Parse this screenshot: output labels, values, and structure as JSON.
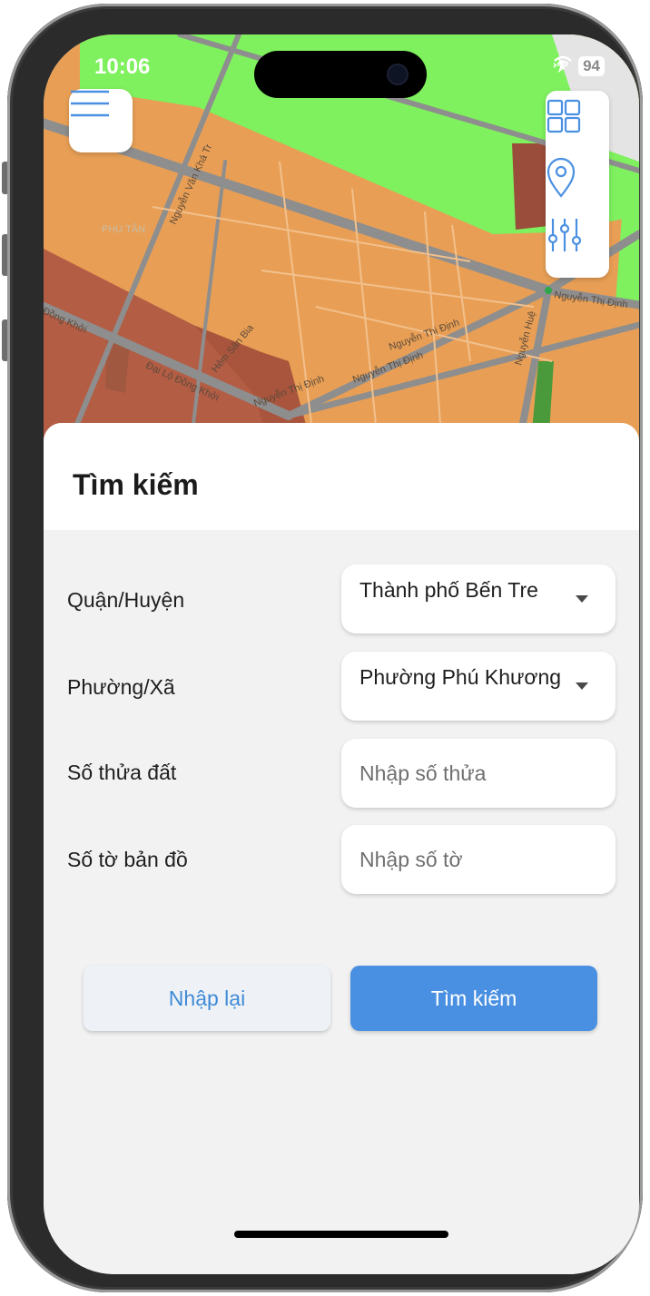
{
  "status_bar": {
    "time": "10:06",
    "battery": "94",
    "icons": [
      "airplane-icon",
      "wifi-icon",
      "battery-icon"
    ]
  },
  "map": {
    "labels": [
      "PHÚ TÂN",
      "Nguyễn Văn Khá Tr",
      "Đồng Khởi",
      "Đại Lộ Đồng Khởi",
      "Hẻm Sân Bia",
      "Nguyễn Thị Định",
      "Nguyễn Thị Định",
      "Nguyễn Thị Định",
      "Nguyễn Thị Định",
      "Nguyễn Huệ"
    ],
    "toolbar_icons": [
      "grid-icon",
      "location-pin-icon",
      "sliders-icon"
    ]
  },
  "sheet": {
    "title": "Tìm kiếm",
    "fields": {
      "district": {
        "label": "Quận/Huyện",
        "value": "Thành phố Bến Tre"
      },
      "ward": {
        "label": "Phường/Xã",
        "value": "Phường Phú Khương"
      },
      "parcel": {
        "label": "Số thửa đất",
        "placeholder": "Nhập số thửa",
        "value": ""
      },
      "sheet_no": {
        "label": "Số tờ bản đồ",
        "placeholder": "Nhập số tờ",
        "value": ""
      }
    },
    "buttons": {
      "reset": "Nhập lại",
      "search": "Tìm kiếm"
    }
  },
  "colors": {
    "map_orange": "#e89f55",
    "map_green": "#7ff05e",
    "map_brown": "#b35d45",
    "map_road": "#8e8e8e",
    "accent": "#4a90e2"
  }
}
